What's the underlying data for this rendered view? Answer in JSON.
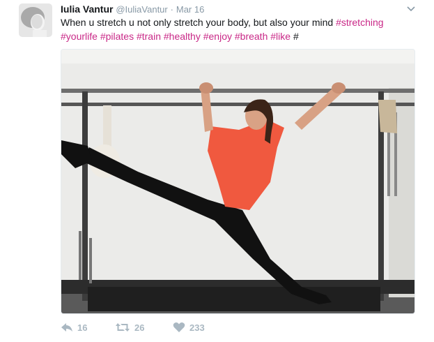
{
  "tweet": {
    "author_name": "Iulia Vantur",
    "handle": "@IuliaVantur",
    "separator": "·",
    "date": "Mar 16",
    "text_plain": "When u stretch u not only stretch your body, but also your mind ",
    "hashtags_line1": [
      "#stretching"
    ],
    "hashtags_line2": [
      "#yourlife",
      "#pilates",
      "#train",
      "#healthy",
      "#enjoy",
      "#breath",
      "#like"
    ],
    "trailing_text": "#",
    "replies": "16",
    "retweets": "26",
    "likes": "233"
  },
  "icons": {
    "avatar": "avatar",
    "caret": "chevron-down-icon",
    "reply": "reply-icon",
    "retweet": "retweet-icon",
    "like": "heart-icon"
  },
  "colors": {
    "hashtag": "#c92887",
    "text": "#14171a",
    "muted": "#8899a6",
    "action": "#aab8c2"
  }
}
